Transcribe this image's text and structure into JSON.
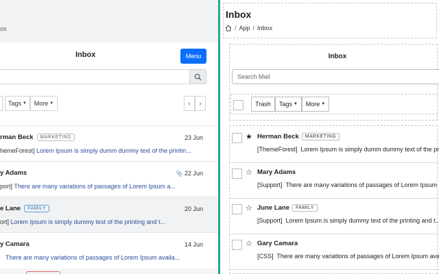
{
  "left": {
    "breadcrumb_tail": "ox",
    "header_title": "Inbox",
    "menu_label": "Menu",
    "toolbar": {
      "tags_label": "Tags",
      "more_label": "More"
    },
    "rows": [
      {
        "name": "rman Beck",
        "badge": "MARKETING",
        "badge_style": "gray",
        "date": "23 Jun",
        "prefix": "hemeForest]",
        "text": "Lorem Ipsum is simply dumm dummy text of the printin...",
        "attachment": false
      },
      {
        "name": "y Adams",
        "badge": "",
        "badge_style": "",
        "date": "22 Jun",
        "prefix": "port]",
        "text": "There are many variations of passages of Lorem Ipsum a...",
        "attachment": true
      },
      {
        "name": "e Lane",
        "badge": "FAMILY",
        "badge_style": "blue",
        "date": "20 Jun",
        "prefix": "ort]",
        "text": "Lorem Ipsum is simply dummy text of the printing and t...",
        "attachment": false
      },
      {
        "name": "y Camara",
        "badge": "",
        "badge_style": "",
        "date": "14 Jun",
        "prefix": "",
        "text": "There are many variations of passages of Lorem Ipsum availa...",
        "attachment": false
      }
    ]
  },
  "right": {
    "page_title": "Inbox",
    "breadcrumbs": [
      "App",
      "Inbox"
    ],
    "header_title": "Inbox",
    "search_placeholder": "Search Mail",
    "toolbar": {
      "trash_label": "Trash",
      "tags_label": "Tags",
      "more_label": "More"
    },
    "rows": [
      {
        "name": "Herman Beck",
        "badge": "MARKETING",
        "starred": true,
        "prefix": "[ThemeForest]",
        "text": "Lorem Ipsum is simply dumm dummy text of the pr..."
      },
      {
        "name": "Mary Adams",
        "badge": "",
        "starred": false,
        "prefix": "[Support]",
        "text": "There are many variations of passages of Lorem Ipsum a..."
      },
      {
        "name": "June Lane",
        "badge": "FAMILY",
        "starred": false,
        "prefix": "[Support]",
        "text": "Lorem Ipsum is simply dummy text of the printing and t..."
      },
      {
        "name": "Gary Camara",
        "badge": "",
        "starred": false,
        "prefix": "[CSS]",
        "text": "There are many variations of passages of Lorem Ipsum availa..."
      }
    ]
  },
  "colors": {
    "primary": "#0d6efd",
    "divider": "#2aa198",
    "link_text": "#2a4d9b",
    "badge_blue": "#2e75b6"
  }
}
